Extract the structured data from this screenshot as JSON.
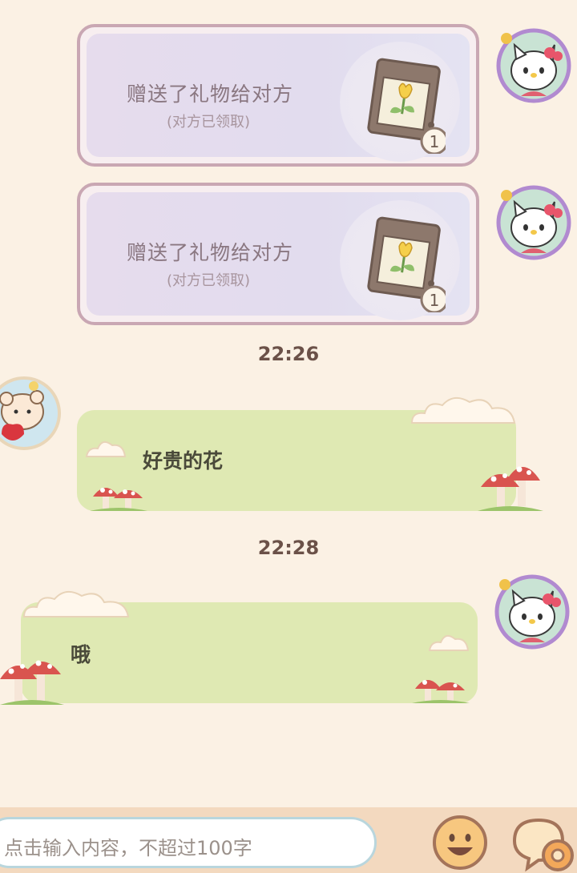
{
  "messages": [
    {
      "type": "gift",
      "title": "赠送了礼物给对方",
      "subtitle": "(对方已领取)",
      "badge": "1",
      "icon": "tulip-seed-pack-icon"
    },
    {
      "type": "gift",
      "title": "赠送了礼物给对方",
      "subtitle": "(对方已领取)",
      "badge": "1",
      "icon": "tulip-seed-pack-icon"
    }
  ],
  "timestamps": [
    "22:26",
    "22:28"
  ],
  "chat": {
    "received_text": "好贵的花",
    "sent_text": "哦"
  },
  "input": {
    "placeholder": "点击输入内容，不超过100字"
  },
  "icons": {
    "emoji": "smiley-icon",
    "settings": "chat-settings-gear-icon",
    "own_avatar": "hello-kitty-avatar-icon",
    "partner_avatar": "bear-with-heart-avatar-icon"
  },
  "colors": {
    "background": "#fbf1e4",
    "bubble_green": "#dfe9b3",
    "gift_border": "#c9a7b3",
    "gift_fill": "#e4def0",
    "timestamp": "#6b5148"
  }
}
